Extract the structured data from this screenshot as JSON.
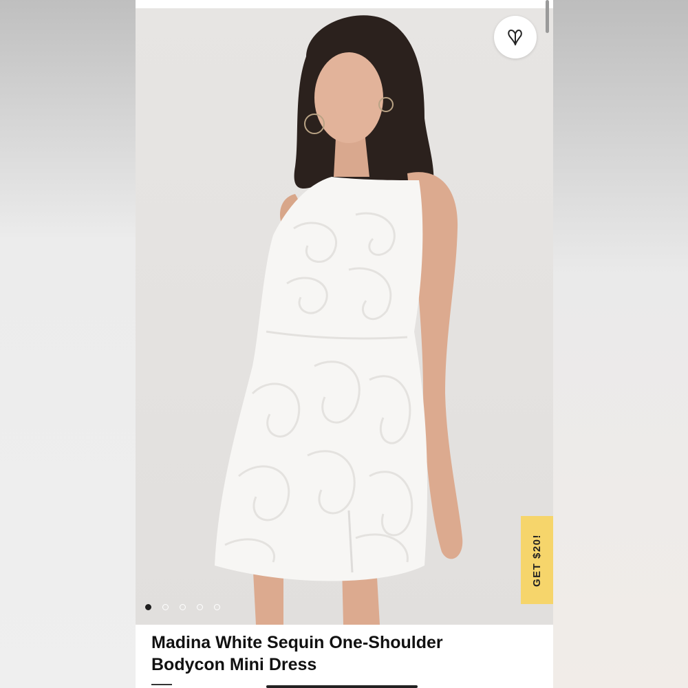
{
  "product": {
    "title_line1": "Madina White Sequin One-Shoulder",
    "title_line2": "Bodycon Mini Dress"
  },
  "gallery": {
    "slide_count": 5,
    "active_index": 0
  },
  "promo": {
    "label": "GET $20!",
    "color": "#f6d56b"
  },
  "icons": {
    "wishlist": "heart-icon"
  }
}
